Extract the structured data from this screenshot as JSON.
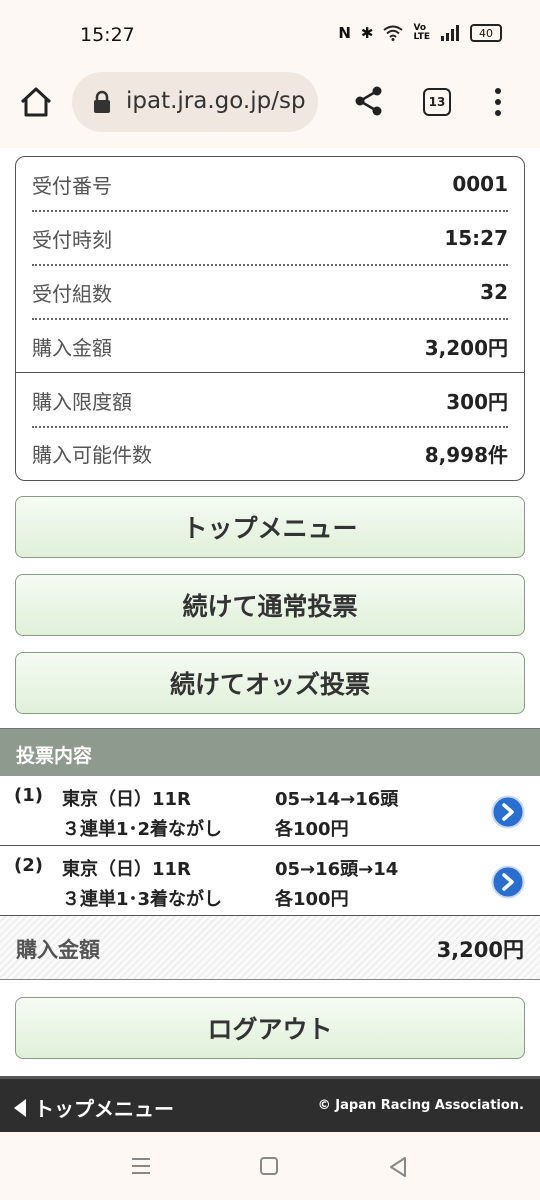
{
  "status_bar": {
    "time": "15:27",
    "battery": "40",
    "icons": [
      "nfc-icon",
      "bluetooth-icon",
      "wifi-icon",
      "volte-icon",
      "signal-icon",
      "battery-icon"
    ]
  },
  "browser": {
    "url": "ipat.jra.go.jp/sp",
    "tab_count": "13"
  },
  "summary": {
    "rows": [
      {
        "label": "受付番号",
        "value": "0001"
      },
      {
        "label": "受付時刻",
        "value": "15:27"
      },
      {
        "label": "受付組数",
        "value": "32"
      },
      {
        "label": "購入金額",
        "value": "3,200円"
      },
      {
        "label": "購入限度額",
        "value": "300円"
      },
      {
        "label": "購入可能件数",
        "value": "8,998件"
      }
    ]
  },
  "buttons": {
    "top_menu": "トップメニュー",
    "continue_normal": "続けて通常投票",
    "continue_odds": "続けてオッズ投票",
    "logout": "ログアウト"
  },
  "votes": {
    "header": "投票内容",
    "items": [
      {
        "num": "(1)",
        "race": "東京（日）11R",
        "combination": "05→14→16頭",
        "bet_type": "３連単1･2着ながし",
        "amount": "各100円"
      },
      {
        "num": "(2)",
        "race": "東京（日）11R",
        "combination": "05→16頭→14",
        "bet_type": "３連単1･3着ながし",
        "amount": "各100円"
      }
    ]
  },
  "total": {
    "label": "購入金額",
    "value": "3,200円"
  },
  "footer": {
    "back_label": "トップメニュー",
    "copyright": "© Japan Racing Association."
  },
  "colors": {
    "button_green_top": "#f6fbf4",
    "button_green_bottom": "#dff0d8",
    "section_header": "#8e9a8e",
    "footer_bg": "#2e2e2e",
    "arrow_blue": "#2a6fd0"
  }
}
